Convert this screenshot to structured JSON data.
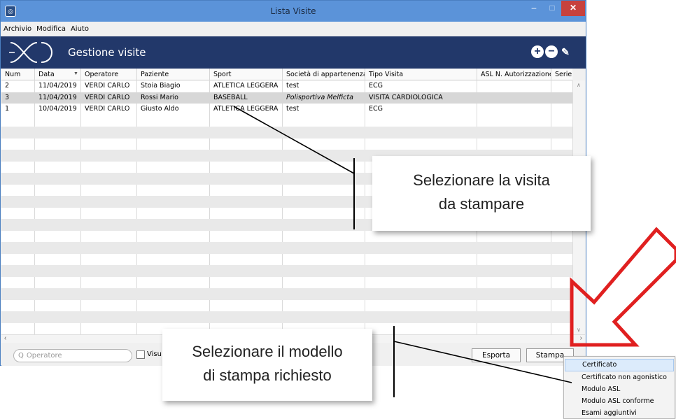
{
  "window": {
    "title": "Lista Visite",
    "min_label": "–",
    "max_label": "□",
    "close_label": "✕"
  },
  "menubar": {
    "items": [
      {
        "label": "Archivio"
      },
      {
        "label": "Modifica"
      },
      {
        "label": "Aiuto"
      }
    ]
  },
  "header": {
    "title": "Gestione visite",
    "icons": [
      "add-icon",
      "remove-icon",
      "edit-icon"
    ]
  },
  "table": {
    "columns": [
      "Num",
      "Data",
      "Operatore",
      "Paziente",
      "Sport",
      "Società di appartenenza",
      "Tipo Visita",
      "ASL N. Autorizzazione",
      "Serie cert"
    ],
    "sort_indicator": "▼",
    "rows": [
      {
        "num": "2",
        "data": "11/04/2019",
        "operatore": "VERDI CARLO",
        "paziente": "Stoia Biagio",
        "sport": "ATLETICA LEGGERA",
        "societa": "test",
        "tipo": "ECG"
      },
      {
        "num": "3",
        "data": "11/04/2019",
        "operatore": "VERDI CARLO",
        "paziente": "Rossi Mario",
        "sport": "BASEBALL",
        "societa": "Polisportiva Melficta",
        "tipo": "VISITA CARDIOLOGICA"
      },
      {
        "num": "1",
        "data": "10/04/2019",
        "operatore": "VERDI CARLO",
        "paziente": "Giusto Aldo",
        "sport": "ATLETICA LEGGERA",
        "societa": "test",
        "tipo": "ECG"
      }
    ]
  },
  "footer": {
    "search_placeholder": "Operatore",
    "search_glyph": "Q",
    "checkbox_label": "Visu",
    "export_label": "Esporta",
    "print_label": "Stampa"
  },
  "print_menu": {
    "items": [
      "Certificato",
      "Certificato non agonistico",
      "Modulo ASL",
      "Modulo ASL conforme",
      "Esami aggiuntivi"
    ]
  },
  "callouts": {
    "select_visit_line1": "Selezionare la visita",
    "select_visit_line2": "da stampare",
    "select_model_line1": "Selezionare il modello",
    "select_model_line2": "di stampa richiesto"
  },
  "colors": {
    "titlebar": "#5b93d9",
    "header": "#22386a",
    "close": "#c7413d",
    "arrow": "#e02020",
    "selected_row": "#d7d7d7",
    "menu_hover": "#dcebfb"
  }
}
